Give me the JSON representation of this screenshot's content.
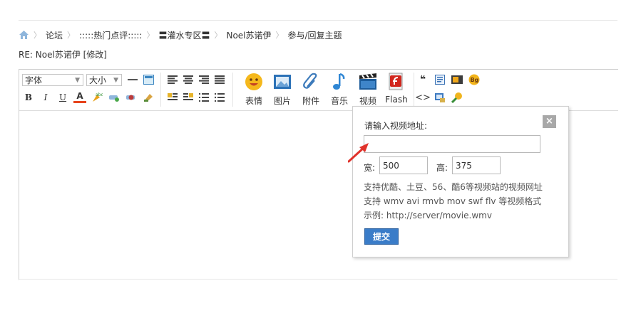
{
  "breadcrumb": {
    "items": [
      "论坛",
      ":::::热门点评:::::",
      "〓灌水专区〓",
      "Noel苏诺伊",
      "参与/回复主题"
    ]
  },
  "post": {
    "title": "RE: Noel苏诺伊 [修改]"
  },
  "toolbar": {
    "font_label": "字体",
    "size_label": "大小",
    "buttons": {
      "bold": "B",
      "italic": "I",
      "underline": "U",
      "fontcolor": "A"
    },
    "big_buttons": [
      "表情",
      "图片",
      "附件",
      "音乐",
      "视频",
      "Flash"
    ]
  },
  "video_dialog": {
    "title": "请输入视频地址:",
    "close_label": "×",
    "url_value": "",
    "width_label": "宽:",
    "width_value": "500",
    "height_label": "高:",
    "height_value": "375",
    "info_lines": [
      "支持优酷、土豆、56、酷6等视频站的视频网址",
      "支持 wmv avi rmvb mov swf flv 等视频格式",
      "示例: http://server/movie.wmv"
    ],
    "submit_label": "提交"
  },
  "colors": {
    "accent": "#3a7cc8",
    "arrow": "#e0322b"
  }
}
